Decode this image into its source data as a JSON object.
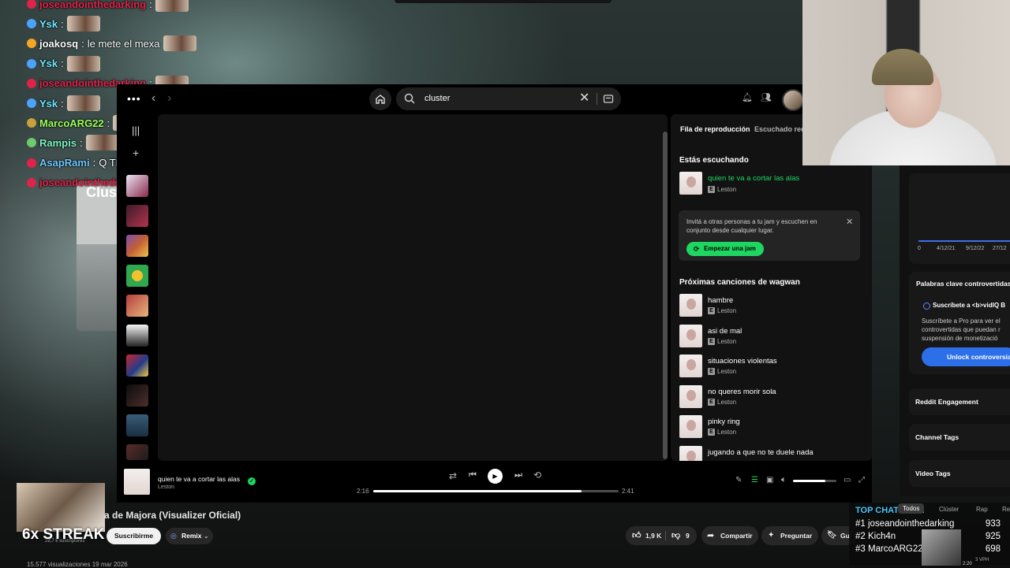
{
  "chat": [
    {
      "user": "joseandointhedarking",
      "msg": "",
      "color": "#e0234a"
    },
    {
      "user": "Ysk",
      "msg": "",
      "color": "#6fe7ff"
    },
    {
      "user": "joakosq",
      "msg": "le mete el mexa",
      "color": "#ffffff"
    },
    {
      "user": "Ysk",
      "msg": "",
      "color": "#6fe7ff"
    },
    {
      "user": "joseandointhedarking",
      "msg": "",
      "color": "#e0234a"
    },
    {
      "user": "Ysk",
      "msg": "",
      "color": "#6fe7ff"
    },
    {
      "user": "MarcoARG22",
      "msg": "",
      "color": "#9bff5a"
    },
    {
      "user": "Rampis",
      "msg": "",
      "color": "#7cf5c4"
    },
    {
      "user": "AsapRami",
      "msg": "Q TEMASO",
      "color": "#6fc6ff"
    },
    {
      "user": "joseandointhedarking",
      "msg": "",
      "color": "#e0234a"
    }
  ],
  "yt_left_card_title": "Clus",
  "spotify": {
    "search_value": "cluster",
    "queue": {
      "tab_queue": "Fila de reproducción",
      "tab_recent": "Escuchado recie",
      "now_playing_title": "Estás escuchando",
      "now_track": "quien te va a cortar las alas",
      "now_artist": "Leston",
      "jam_text": "Invitá a otras personas a tu jam y escuchen en conjunto desde cualquier lugar.",
      "jam_button": "Empezar una jam",
      "next_title": "Próximas canciones de wagwan",
      "next": [
        {
          "title": "hambre",
          "artist": "Leston"
        },
        {
          "title": "asi de mal",
          "artist": "Leston"
        },
        {
          "title": "situaciones violentas",
          "artist": "Leston"
        },
        {
          "title": "no queres morir sola",
          "artist": "Leston"
        },
        {
          "title": "pinky ring",
          "artist": "Leston"
        },
        {
          "title": "jugando a que no te duele nada",
          "artist": ""
        }
      ],
      "explicit_badge": "E"
    },
    "player": {
      "track": "quien te va a cortar las alas",
      "artist": "Leston",
      "elapsed": "2:16",
      "duration": "2:41",
      "progress": 0.85,
      "volume": 0.75
    },
    "colors": {
      "accent": "#1ed760"
    }
  },
  "vidiq": {
    "axis_ticks": [
      "0",
      "4/12/21",
      "9/12/22",
      "27/12"
    ],
    "keywords_title": "Palabras clave controvertidas",
    "subscribe_title": "Suscríbete a <b>vidIQ B",
    "subscribe_text": "Suscríbete a Pro para ver el controvertidas que puedan r suspensión de monetizació",
    "unlock_button": "Unlock controversia",
    "reddit": "Reddit Engagement",
    "channel_tags": "Channel Tags",
    "video_tags": "Video Tags",
    "tabs": [
      "Todos",
      "Clúster",
      "Rap",
      "Re"
    ]
  },
  "youtube": {
    "video_title": "a de Majora (Visualizer Oficial)",
    "streak": "6x STREAK",
    "channel_subs": "28,7 k suscriptores",
    "subscribe": "Suscribirme",
    "remix": "Remix",
    "likes": "1,9 K",
    "dislikes": "9",
    "share": "Compartir",
    "ask": "Preguntar",
    "save": "Gu",
    "views": "15.577 visualizaciones  19 mar 2026",
    "side_meta": "3 VPH",
    "side_time": "2:20"
  },
  "top_chatters": {
    "title": "TOP CHATTERS:",
    "rows": [
      {
        "rank": "#1",
        "name": "joseandointhedarking",
        "count": "933"
      },
      {
        "rank": "#2",
        "name": "Kich4n",
        "count": "925"
      },
      {
        "rank": "#3",
        "name": "MarcoARG22",
        "count": "698"
      }
    ]
  }
}
